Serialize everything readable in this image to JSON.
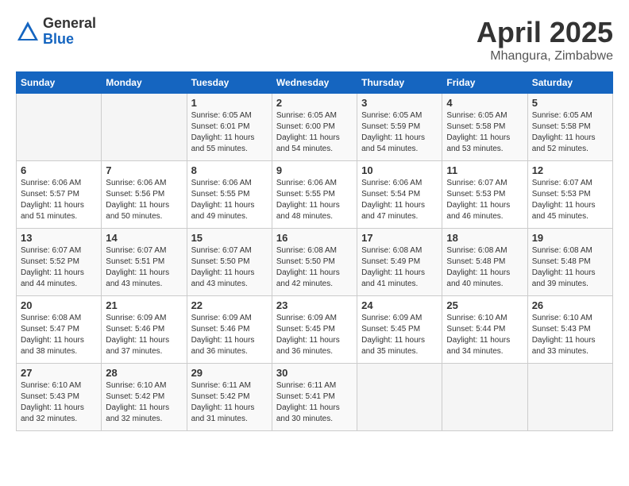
{
  "header": {
    "logo_general": "General",
    "logo_blue": "Blue",
    "month_title": "April 2025",
    "location": "Mhangura, Zimbabwe"
  },
  "calendar": {
    "weekdays": [
      "Sunday",
      "Monday",
      "Tuesday",
      "Wednesday",
      "Thursday",
      "Friday",
      "Saturday"
    ],
    "weeks": [
      [
        {
          "day": "",
          "info": ""
        },
        {
          "day": "",
          "info": ""
        },
        {
          "day": "1",
          "info": "Sunrise: 6:05 AM\nSunset: 6:01 PM\nDaylight: 11 hours\nand 55 minutes."
        },
        {
          "day": "2",
          "info": "Sunrise: 6:05 AM\nSunset: 6:00 PM\nDaylight: 11 hours\nand 54 minutes."
        },
        {
          "day": "3",
          "info": "Sunrise: 6:05 AM\nSunset: 5:59 PM\nDaylight: 11 hours\nand 54 minutes."
        },
        {
          "day": "4",
          "info": "Sunrise: 6:05 AM\nSunset: 5:58 PM\nDaylight: 11 hours\nand 53 minutes."
        },
        {
          "day": "5",
          "info": "Sunrise: 6:05 AM\nSunset: 5:58 PM\nDaylight: 11 hours\nand 52 minutes."
        }
      ],
      [
        {
          "day": "6",
          "info": "Sunrise: 6:06 AM\nSunset: 5:57 PM\nDaylight: 11 hours\nand 51 minutes."
        },
        {
          "day": "7",
          "info": "Sunrise: 6:06 AM\nSunset: 5:56 PM\nDaylight: 11 hours\nand 50 minutes."
        },
        {
          "day": "8",
          "info": "Sunrise: 6:06 AM\nSunset: 5:55 PM\nDaylight: 11 hours\nand 49 minutes."
        },
        {
          "day": "9",
          "info": "Sunrise: 6:06 AM\nSunset: 5:55 PM\nDaylight: 11 hours\nand 48 minutes."
        },
        {
          "day": "10",
          "info": "Sunrise: 6:06 AM\nSunset: 5:54 PM\nDaylight: 11 hours\nand 47 minutes."
        },
        {
          "day": "11",
          "info": "Sunrise: 6:07 AM\nSunset: 5:53 PM\nDaylight: 11 hours\nand 46 minutes."
        },
        {
          "day": "12",
          "info": "Sunrise: 6:07 AM\nSunset: 5:53 PM\nDaylight: 11 hours\nand 45 minutes."
        }
      ],
      [
        {
          "day": "13",
          "info": "Sunrise: 6:07 AM\nSunset: 5:52 PM\nDaylight: 11 hours\nand 44 minutes."
        },
        {
          "day": "14",
          "info": "Sunrise: 6:07 AM\nSunset: 5:51 PM\nDaylight: 11 hours\nand 43 minutes."
        },
        {
          "day": "15",
          "info": "Sunrise: 6:07 AM\nSunset: 5:50 PM\nDaylight: 11 hours\nand 43 minutes."
        },
        {
          "day": "16",
          "info": "Sunrise: 6:08 AM\nSunset: 5:50 PM\nDaylight: 11 hours\nand 42 minutes."
        },
        {
          "day": "17",
          "info": "Sunrise: 6:08 AM\nSunset: 5:49 PM\nDaylight: 11 hours\nand 41 minutes."
        },
        {
          "day": "18",
          "info": "Sunrise: 6:08 AM\nSunset: 5:48 PM\nDaylight: 11 hours\nand 40 minutes."
        },
        {
          "day": "19",
          "info": "Sunrise: 6:08 AM\nSunset: 5:48 PM\nDaylight: 11 hours\nand 39 minutes."
        }
      ],
      [
        {
          "day": "20",
          "info": "Sunrise: 6:08 AM\nSunset: 5:47 PM\nDaylight: 11 hours\nand 38 minutes."
        },
        {
          "day": "21",
          "info": "Sunrise: 6:09 AM\nSunset: 5:46 PM\nDaylight: 11 hours\nand 37 minutes."
        },
        {
          "day": "22",
          "info": "Sunrise: 6:09 AM\nSunset: 5:46 PM\nDaylight: 11 hours\nand 36 minutes."
        },
        {
          "day": "23",
          "info": "Sunrise: 6:09 AM\nSunset: 5:45 PM\nDaylight: 11 hours\nand 36 minutes."
        },
        {
          "day": "24",
          "info": "Sunrise: 6:09 AM\nSunset: 5:45 PM\nDaylight: 11 hours\nand 35 minutes."
        },
        {
          "day": "25",
          "info": "Sunrise: 6:10 AM\nSunset: 5:44 PM\nDaylight: 11 hours\nand 34 minutes."
        },
        {
          "day": "26",
          "info": "Sunrise: 6:10 AM\nSunset: 5:43 PM\nDaylight: 11 hours\nand 33 minutes."
        }
      ],
      [
        {
          "day": "27",
          "info": "Sunrise: 6:10 AM\nSunset: 5:43 PM\nDaylight: 11 hours\nand 32 minutes."
        },
        {
          "day": "28",
          "info": "Sunrise: 6:10 AM\nSunset: 5:42 PM\nDaylight: 11 hours\nand 32 minutes."
        },
        {
          "day": "29",
          "info": "Sunrise: 6:11 AM\nSunset: 5:42 PM\nDaylight: 11 hours\nand 31 minutes."
        },
        {
          "day": "30",
          "info": "Sunrise: 6:11 AM\nSunset: 5:41 PM\nDaylight: 11 hours\nand 30 minutes."
        },
        {
          "day": "",
          "info": ""
        },
        {
          "day": "",
          "info": ""
        },
        {
          "day": "",
          "info": ""
        }
      ]
    ]
  }
}
